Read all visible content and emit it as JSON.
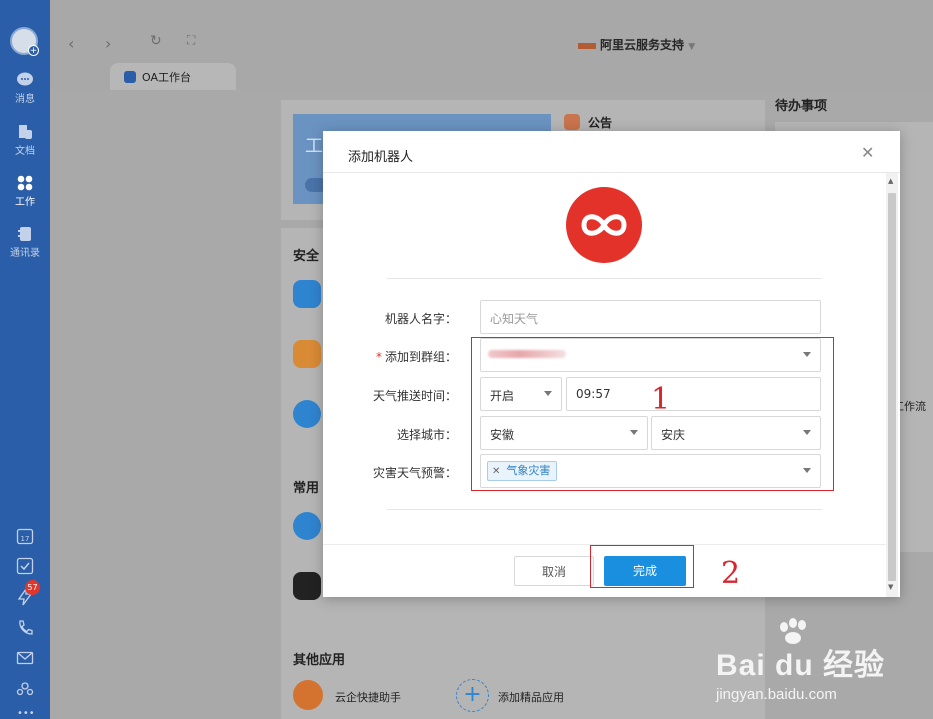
{
  "sidebar": {
    "items": [
      {
        "label": "消息",
        "icon": "chat-bubble-icon"
      },
      {
        "label": "文档",
        "icon": "document-icon"
      },
      {
        "label": "工作",
        "icon": "grid-icon"
      },
      {
        "label": "通讯录",
        "icon": "address-book-icon"
      }
    ],
    "badge_count": "57"
  },
  "topbar": {
    "org_name": "阿里云服务支持",
    "tab_label": "OA工作台"
  },
  "background": {
    "notice_label": "公告",
    "todo_title": "待办事项",
    "banner_text": "工组",
    "section_security": "安全",
    "section_common": "常用",
    "workflow_text": "工作流",
    "section_other": "其他应用",
    "app_helper": "云企快捷助手",
    "app_add": "添加精品应用"
  },
  "dialog": {
    "title": "添加机器人",
    "fields": {
      "name_label": "机器人名字：",
      "name_value": "心知天气",
      "group_label": "添加到群组：",
      "push_label": "天气推送时间：",
      "push_toggle": "开启",
      "push_time": "09:57",
      "city_label": "选择城市：",
      "province": "安徽",
      "city": "安庆",
      "warning_label": "灾害天气预警：",
      "warning_tag": "气象灾害"
    },
    "cancel_label": "取消",
    "confirm_label": "完成"
  },
  "annotations": {
    "marker_1": "1",
    "marker_2": "2"
  },
  "watermark": {
    "brand": "Bai du 经验",
    "url": "jingyan.baidu.com"
  }
}
